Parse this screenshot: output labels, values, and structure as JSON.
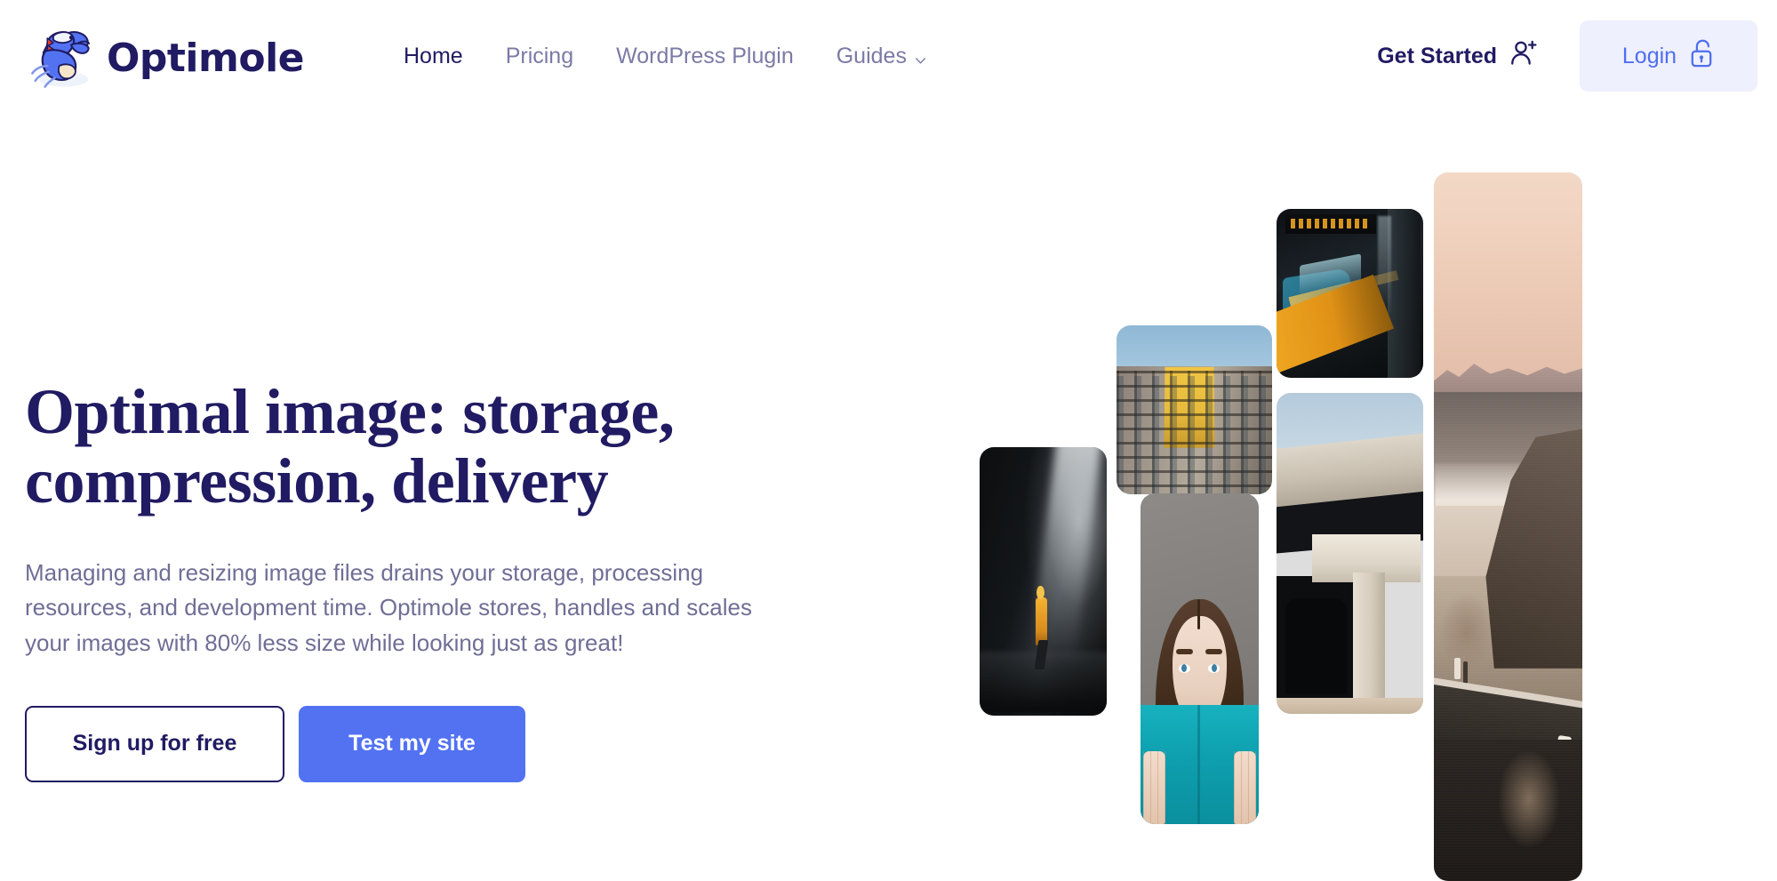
{
  "header": {
    "brand": {
      "name": "Optimole",
      "logo_icon": "optimole-mole-logo"
    },
    "nav": [
      {
        "label": "Home",
        "active": true
      },
      {
        "label": "Pricing",
        "active": false
      },
      {
        "label": "WordPress Plugin",
        "active": false
      },
      {
        "label": "Guides",
        "active": false,
        "icon": "chevron-down-icon"
      }
    ],
    "get_started": {
      "label": "Get Started",
      "icon": "user-plus-icon"
    },
    "login": {
      "label": "Login",
      "icon": "unlocked-padlock-icon"
    }
  },
  "hero": {
    "title_line1": "Optimal image: storage,",
    "title_line2": "compression, delivery",
    "subtitle": "Managing and resizing image files drains your storage, processing resources, and development time. Optimole stores, handles and scales your images with 80% less size while looking just as great!",
    "primary_cta": "Test my site",
    "secondary_cta": "Sign up for free"
  },
  "collage": {
    "photos": [
      {
        "alt": "hiker-in-yellow-jacket-in-dark-cave"
      },
      {
        "alt": "building-facade-with-golden-sunlight"
      },
      {
        "alt": "teal-subway-train-at-station-platform"
      },
      {
        "alt": "woman-holding-teal-book-over-face"
      },
      {
        "alt": "concrete-overpass-bridge-underside"
      },
      {
        "alt": "coastal-beach-with-road-at-sunset"
      }
    ]
  },
  "colors": {
    "brand_navy": "#201b62",
    "accent_blue": "#5272f2",
    "login_blue": "#4f6ef0",
    "login_bg": "#eef0fd",
    "body_text": "#6f6e96",
    "nav_inactive": "#7b7aa6"
  }
}
